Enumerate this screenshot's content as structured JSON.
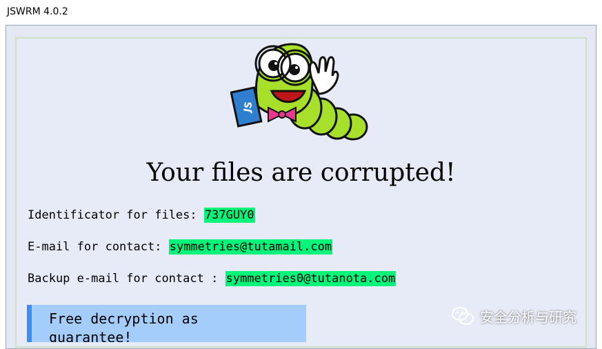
{
  "window": {
    "title": "JSWRM 4.0.2"
  },
  "mascot": {
    "name": "bookworm-mascot-icon",
    "book_label": "JS"
  },
  "main": {
    "headline": "Your files are corrupted!",
    "fields": [
      {
        "label": "Identificator for files: ",
        "value": "737GUY0"
      },
      {
        "label": "E-mail for contact: ",
        "value": "symmetries@tutamail.com"
      },
      {
        "label": "Backup e-mail for contact : ",
        "value": "symmetries0@tutanota.com"
      }
    ],
    "banner": "Free decryption as guarantee!"
  },
  "watermark": {
    "text": "安全分析与研究"
  },
  "colors": {
    "highlight": "#00f57a",
    "banner_bg": "#a4cdfb",
    "banner_border": "#3a8ef4",
    "worm_green": "#a6e02a",
    "bowtie": "#e8388e"
  }
}
